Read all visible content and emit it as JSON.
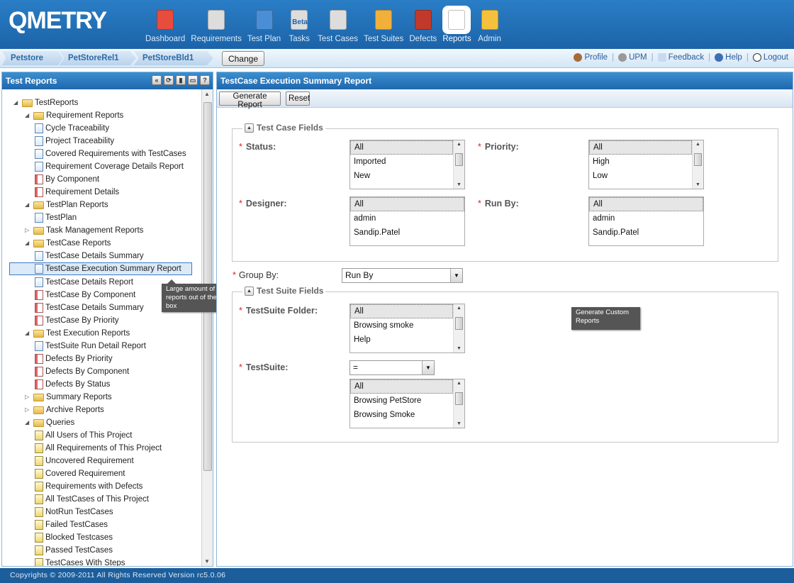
{
  "app": {
    "logo": "QMETRY"
  },
  "nav": [
    {
      "label": "Dashboard",
      "icon": "dashboard-icon",
      "color": "#e74c3c"
    },
    {
      "label": "Requirements",
      "icon": "requirements-icon",
      "color": "#ddd"
    },
    {
      "label": "Test Plan",
      "icon": "test-plan-icon",
      "color": "#4a8fd6"
    },
    {
      "label": "Tasks",
      "icon": "tasks-icon",
      "color": "#ddd",
      "badge": "Beta"
    },
    {
      "label": "Test Cases",
      "icon": "test-cases-icon",
      "color": "#ddd"
    },
    {
      "label": "Test Suites",
      "icon": "test-suites-icon",
      "color": "#f0b03a"
    },
    {
      "label": "Defects",
      "icon": "defects-icon",
      "color": "#c0392b"
    },
    {
      "label": "Reports",
      "icon": "reports-icon",
      "color": "#fff"
    },
    {
      "label": "Admin",
      "icon": "admin-icon",
      "color": "#f5c13d"
    }
  ],
  "context": {
    "project": "Petstore",
    "release": "PetStoreRel1",
    "build": "PetStoreBld1",
    "change_label": "Change"
  },
  "toplinks": {
    "profile": "Profile",
    "upm": "UPM",
    "feedback": "Feedback",
    "help": "Help",
    "logout": "Logout"
  },
  "left": {
    "title": "Test Reports",
    "tree": [
      "TestReports",
      "Requirement Reports",
      "Cycle Traceability",
      "Project Traceability",
      "Covered Requirements with TestCases",
      "Requirement Coverage Details Report",
      "By Component",
      "Requirement Details",
      "TestPlan Reports",
      "TestPlan",
      "Task Management Reports",
      "TestCase Reports",
      "TestCase Details Summary",
      "TestCase Execution Summary Report",
      "TestCase Details Report",
      "TestCase By Component",
      "TestCase Details Summary",
      "TestCase By Priority",
      "Test Execution Reports",
      "TestSuite Run Detail Report",
      "Defects By Priority",
      "Defects By Component",
      "Defects By Status",
      "Summary Reports",
      "Archive Reports",
      "Queries",
      "All Users of This Project",
      "All Requirements of This Project",
      "Uncovered Requirement",
      "Covered Requirement",
      "Requirements with Defects",
      "All TestCases of This Project",
      "NotRun TestCases",
      "Failed TestCases",
      "Blocked Testcases",
      "Passed TestCases",
      "TestCases With Steps"
    ],
    "tip": "Large amount of reports out of the box"
  },
  "main": {
    "title": "TestCase Execution Summary Report",
    "generate": "Generate Report",
    "reset": "Reset",
    "tc_fields": "Test Case Fields",
    "status": {
      "label": "Status:",
      "options": [
        "All",
        "Imported",
        "New"
      ]
    },
    "priority": {
      "label": "Priority:",
      "options": [
        "All",
        "High",
        "Low"
      ]
    },
    "designer": {
      "label": "Designer:",
      "options": [
        "All",
        "admin",
        "Sandip.Patel"
      ]
    },
    "runby": {
      "label": "Run By:",
      "options": [
        "All",
        "admin",
        "Sandip.Patel"
      ]
    },
    "groupby": {
      "label": "Group By:",
      "value": "Run By"
    },
    "ts_fields": "Test Suite Fields",
    "tsfolder": {
      "label": "TestSuite Folder:",
      "options": [
        "All",
        "Browsing smoke",
        "Help"
      ]
    },
    "testsuite": {
      "label": "TestSuite:",
      "op": "=",
      "options": [
        "All",
        "Browsing PetStore",
        "Browsing Smoke"
      ]
    },
    "tip": "Generate Custom Reports"
  },
  "footer": "Copyrights © 2009-2011 All Rights Reserved Version rc5.0.06"
}
